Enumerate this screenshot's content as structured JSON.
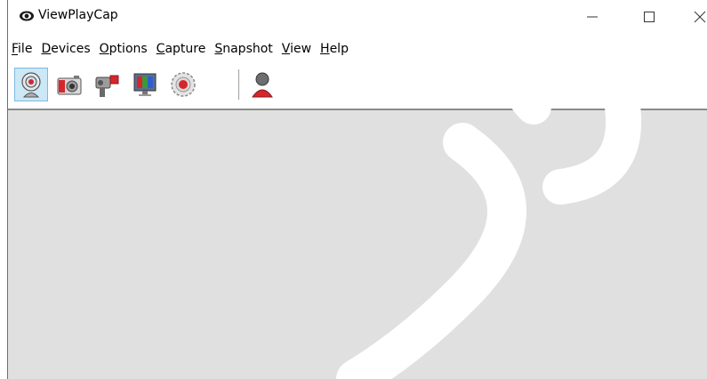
{
  "window": {
    "title": "ViewPlayCap",
    "app_icon": "eye-icon"
  },
  "window_controls": [
    {
      "name": "minimize",
      "icon": "minimize-icon"
    },
    {
      "name": "maximize",
      "icon": "maximize-icon"
    },
    {
      "name": "close",
      "icon": "close-icon"
    }
  ],
  "menubar": {
    "items": [
      {
        "label": "File",
        "mnemonic": "F"
      },
      {
        "label": "Devices",
        "mnemonic": "D"
      },
      {
        "label": "Options",
        "mnemonic": "O"
      },
      {
        "label": "Capture",
        "mnemonic": "C"
      },
      {
        "label": "Snapshot",
        "mnemonic": "S"
      },
      {
        "label": "View",
        "mnemonic": "V"
      },
      {
        "label": "Help",
        "mnemonic": "H"
      }
    ]
  },
  "toolbar": {
    "buttons": [
      {
        "icon": "webcam-icon",
        "active": true
      },
      {
        "icon": "camera-icon",
        "active": false
      },
      {
        "icon": "video-camera-icon",
        "active": false
      },
      {
        "icon": "monitor-icon",
        "active": false
      },
      {
        "icon": "record-icon",
        "active": false
      },
      {
        "icon": "person-icon",
        "active": false
      }
    ]
  },
  "colors": {
    "client_bg": "#e0e0e0",
    "active_button_bg": "#cbe8f6",
    "record_red": "#d6262b"
  }
}
